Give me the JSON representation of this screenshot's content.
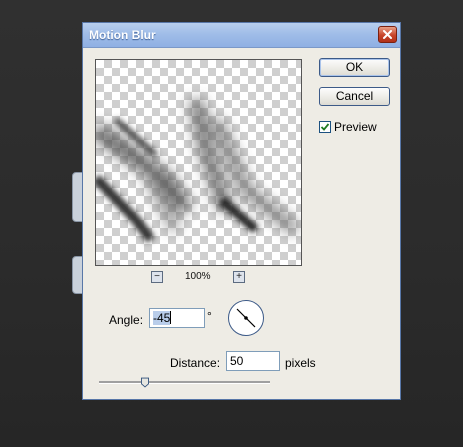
{
  "dialog": {
    "title": "Motion Blur",
    "ok_label": "OK",
    "cancel_label": "Cancel",
    "preview_label": "Preview",
    "preview_checked": true,
    "zoom": {
      "minus": "−",
      "plus": "+",
      "level": "100%"
    },
    "angle": {
      "label": "Angle:",
      "value": "-45",
      "unit": "°"
    },
    "distance": {
      "label": "Distance:",
      "value": "50",
      "unit": "pixels",
      "slider_fraction": 0.27
    }
  },
  "colors": {
    "title_gradient": "#a0bde8",
    "close_button": "#c8452a",
    "dialog_bg": "#eeece5"
  }
}
